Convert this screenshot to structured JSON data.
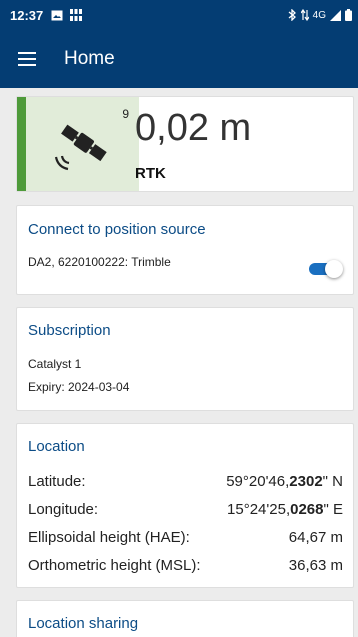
{
  "statusbar": {
    "time": "12:37",
    "network": "4G",
    "icons": [
      "image-icon",
      "grid-icon",
      "bluetooth-icon",
      "data-arrows-icon",
      "signal-icon",
      "battery-icon"
    ]
  },
  "appbar": {
    "title": "Home",
    "color": "#043d73"
  },
  "gnss": {
    "satellite_count": "9",
    "accuracy": "0,02 m",
    "fix_type": "RTK",
    "status_color": "#4e9a3a"
  },
  "connect": {
    "title": "Connect to position source",
    "device": "DA2, 6220100222: Trimble",
    "enabled": true
  },
  "subscription": {
    "title": "Subscription",
    "plan": "Catalyst 1",
    "expiry": "Expiry: 2024-03-04"
  },
  "location": {
    "title": "Location",
    "rows": [
      {
        "label": "Latitude:",
        "prefix": "59°20'46,",
        "bold": "2302",
        "suffix": "\" N"
      },
      {
        "label": "Longitude:",
        "prefix": "15°24'25,",
        "bold": "0268",
        "suffix": "\" E"
      },
      {
        "label": "Ellipsoidal height (HAE):",
        "value": "64,67 m"
      },
      {
        "label": "Orthometric height (MSL):",
        "value": "36,63 m"
      }
    ]
  },
  "sharing": {
    "title": "Location sharing"
  }
}
